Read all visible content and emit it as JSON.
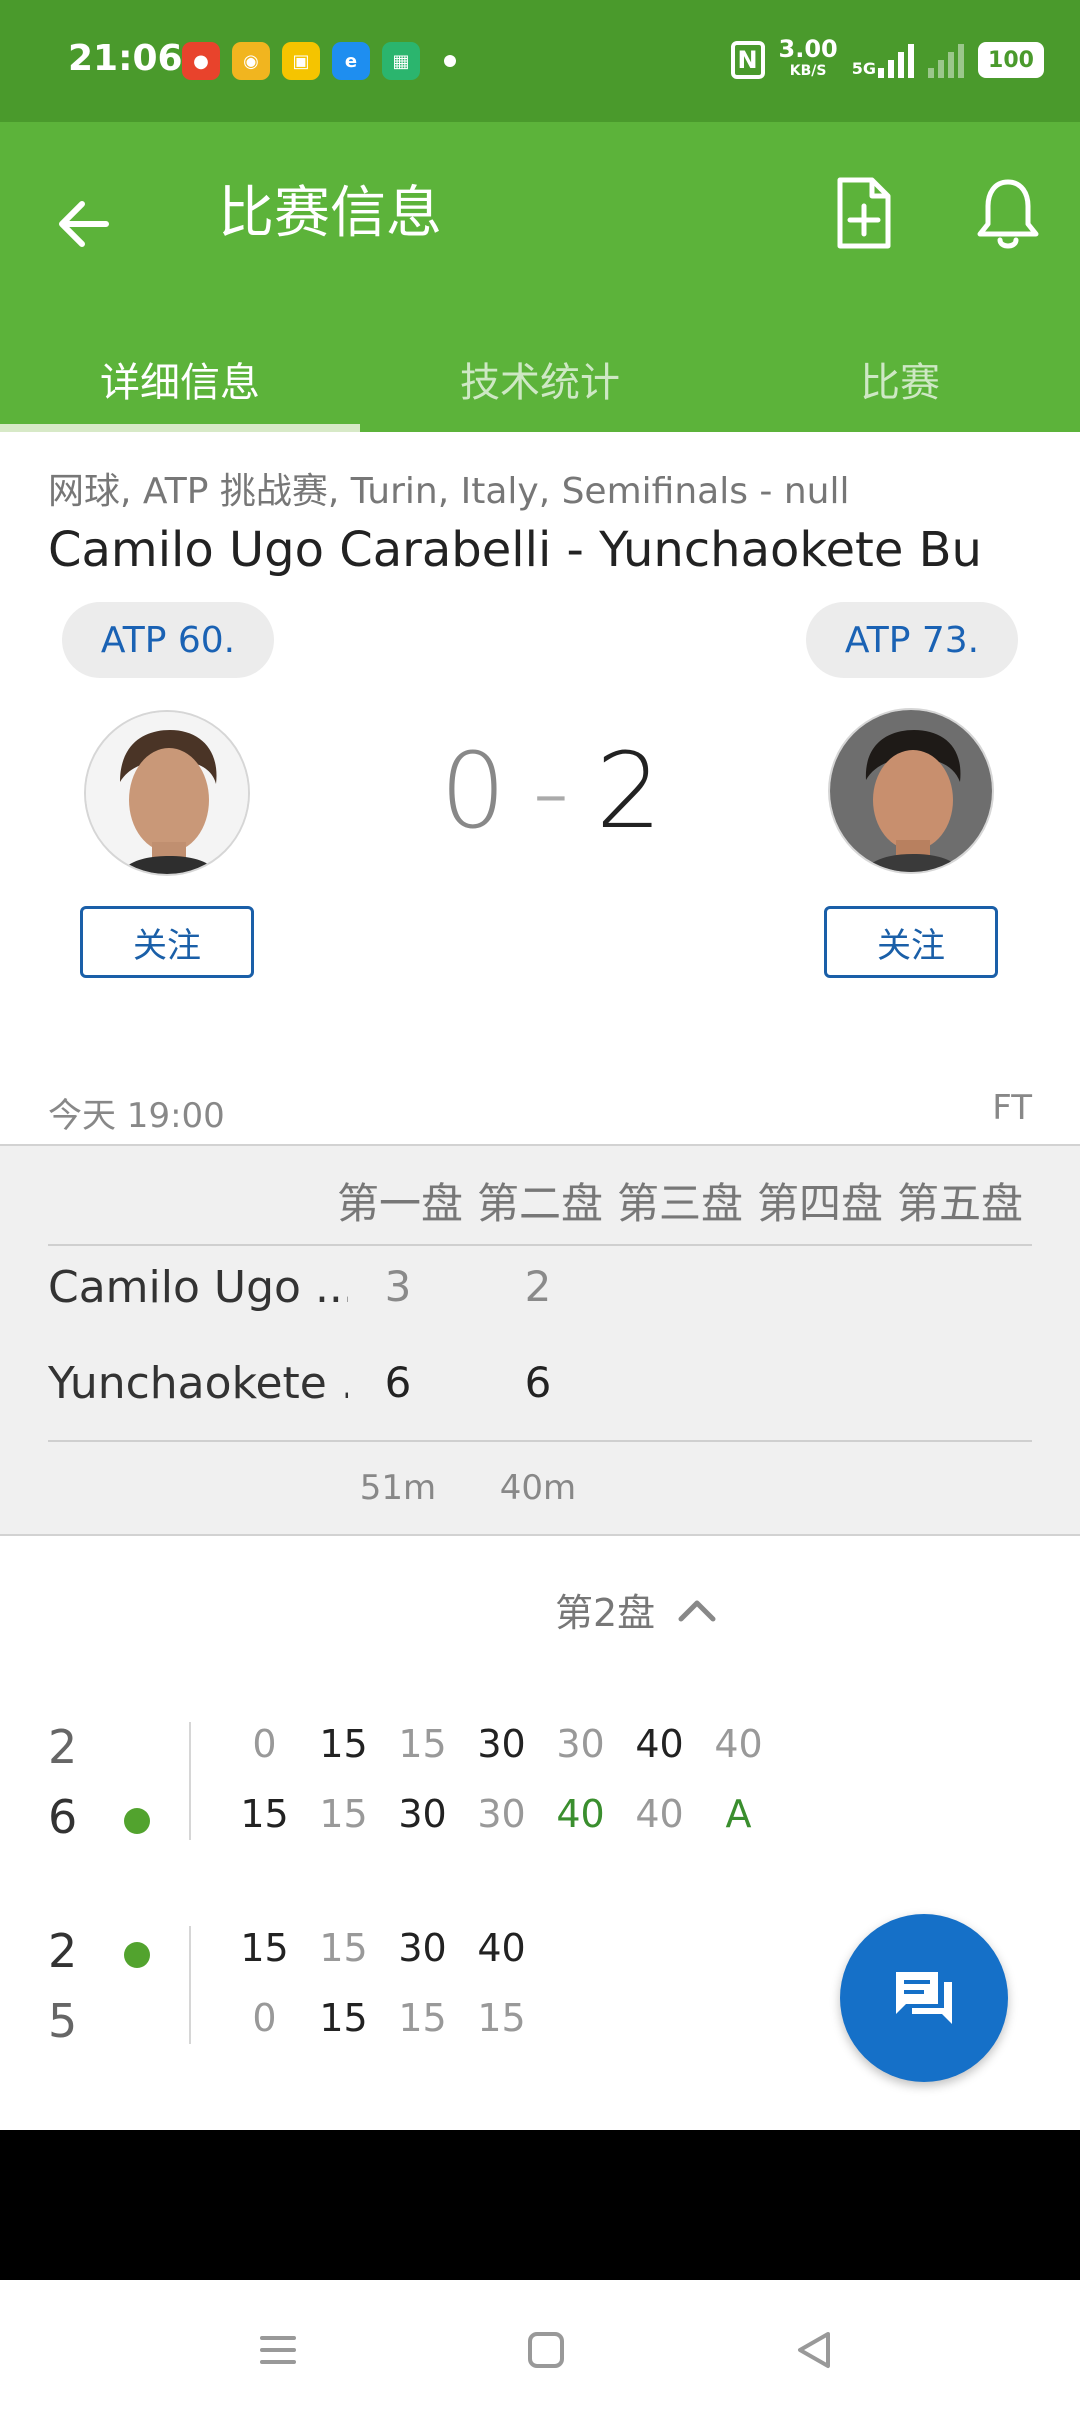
{
  "status_bar": {
    "time": "21:06",
    "net_speed": "3.00",
    "net_unit": "KB/S",
    "net_type": "5G",
    "battery": "100"
  },
  "header": {
    "title": "比赛信息",
    "tabs": [
      {
        "label": "详细信息",
        "active": true
      },
      {
        "label": "技术统计",
        "active": false
      },
      {
        "label": "比赛",
        "active": false
      }
    ]
  },
  "match": {
    "subtitle": "网球, ATP 挑战赛, Turin, Italy, Semifinals - null",
    "title": "Camilo Ugo Carabelli - Yunchaokete Bu",
    "home": {
      "rank": "ATP 60.",
      "follow_label": "关注"
    },
    "away": {
      "rank": "ATP 73.",
      "follow_label": "关注"
    },
    "score_home": "0",
    "score_sep": "-",
    "score_away": "2",
    "date": "今天 19:00",
    "status": "FT"
  },
  "sets": {
    "headers": [
      "第一盘",
      "第二盘",
      "第三盘",
      "第四盘",
      "第五盘"
    ],
    "players": [
      {
        "name": "Camilo Ugo ...",
        "scores": [
          "3",
          "2"
        ]
      },
      {
        "name": "Yunchaokete ...",
        "scores": [
          "6",
          "6"
        ]
      }
    ],
    "durations": [
      "51m",
      "40m"
    ]
  },
  "point_by_point": {
    "set_label": "第2盘",
    "games": [
      {
        "home_games": "2",
        "away_games": "6",
        "server": "away",
        "home_points": [
          "0",
          "15",
          "15",
          "30",
          "30",
          "40",
          "40"
        ],
        "away_points": [
          "15",
          "15",
          "30",
          "30",
          "40",
          "40",
          "A"
        ]
      },
      {
        "home_games": "2",
        "away_games": "5",
        "server": "home",
        "home_points": [
          "15",
          "15",
          "30",
          "40"
        ],
        "away_points": [
          "0",
          "15",
          "15",
          "15"
        ]
      }
    ]
  },
  "colors": {
    "status_bar": "#4a9a2c",
    "app_bar": "#5cb33a",
    "accent_blue": "#1570c8",
    "serve_green": "#52a32e"
  }
}
